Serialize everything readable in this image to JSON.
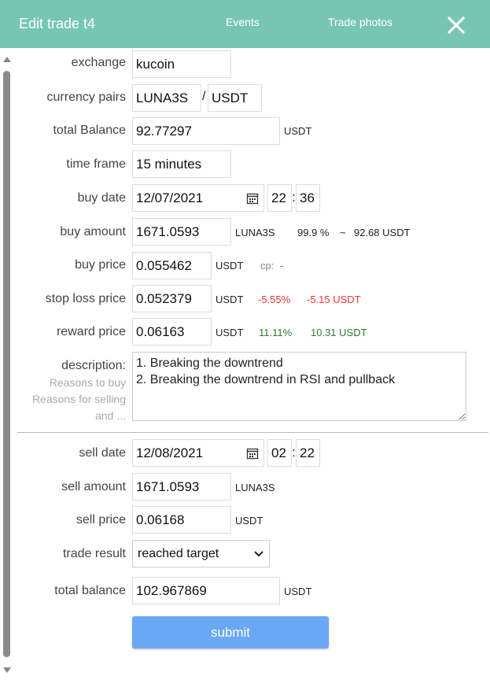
{
  "header": {
    "title": "Edit trade t4",
    "tabs": [
      "Events",
      "Trade photos"
    ],
    "close_icon": "close-icon",
    "bg_color": "#77c6b3"
  },
  "form": {
    "exchange": {
      "label": "exchange",
      "value": "kucoin"
    },
    "pairs": {
      "label": "currency pairs",
      "base": "LUNA3S",
      "sep": "/",
      "quote": "USDT"
    },
    "total_balance": {
      "label": "total Balance",
      "value": "92.77297",
      "unit": "USDT"
    },
    "time_frame": {
      "label": "time frame",
      "value": "15 minutes"
    },
    "buy_date": {
      "label": "buy date",
      "date": "12/07/2021",
      "hour": "22",
      "minute": "36",
      "sep": ":"
    },
    "buy_amount": {
      "label": "buy amount",
      "value": "1671.0593",
      "unit": "LUNA3S",
      "percent": "99.9 %",
      "tilde": "~",
      "approx": "92.68 USDT"
    },
    "buy_price": {
      "label": "buy price",
      "value": "0.055462",
      "unit": "USDT",
      "cp_label": "cp:",
      "cp_value": "-"
    },
    "stop_loss": {
      "label": "stop loss price",
      "value": "0.052379",
      "unit": "USDT",
      "pct": "-5.55%",
      "amount": "-5.15 USDT"
    },
    "reward": {
      "label": "reward price",
      "value": "0.06163",
      "unit": "USDT",
      "pct": "11.11%",
      "amount": "10.31 USDT"
    },
    "description": {
      "label": "description:",
      "hint1": "Reasons to buy",
      "hint2": "Reasons for selling",
      "hint3": "and ...",
      "value": "1. Breaking the downtrend\n2. Breaking the downtrend in RSI and pullback"
    },
    "sell_date": {
      "label": "sell date",
      "date": "12/08/2021",
      "hour": "02",
      "minute": "22",
      "sep": ":"
    },
    "sell_amount": {
      "label": "sell amount",
      "value": "1671.0593",
      "unit": "LUNA3S"
    },
    "sell_price": {
      "label": "sell price",
      "value": "0.06168",
      "unit": "USDT"
    },
    "trade_result": {
      "label": "trade result",
      "value": "reached target"
    },
    "total_balance2": {
      "label": "total balance",
      "value": "102.967869",
      "unit": "USDT"
    },
    "submit_label": "submit"
  },
  "colors": {
    "negative": "#e53935",
    "positive": "#2e7d32",
    "submit": "#6aa8f5"
  }
}
